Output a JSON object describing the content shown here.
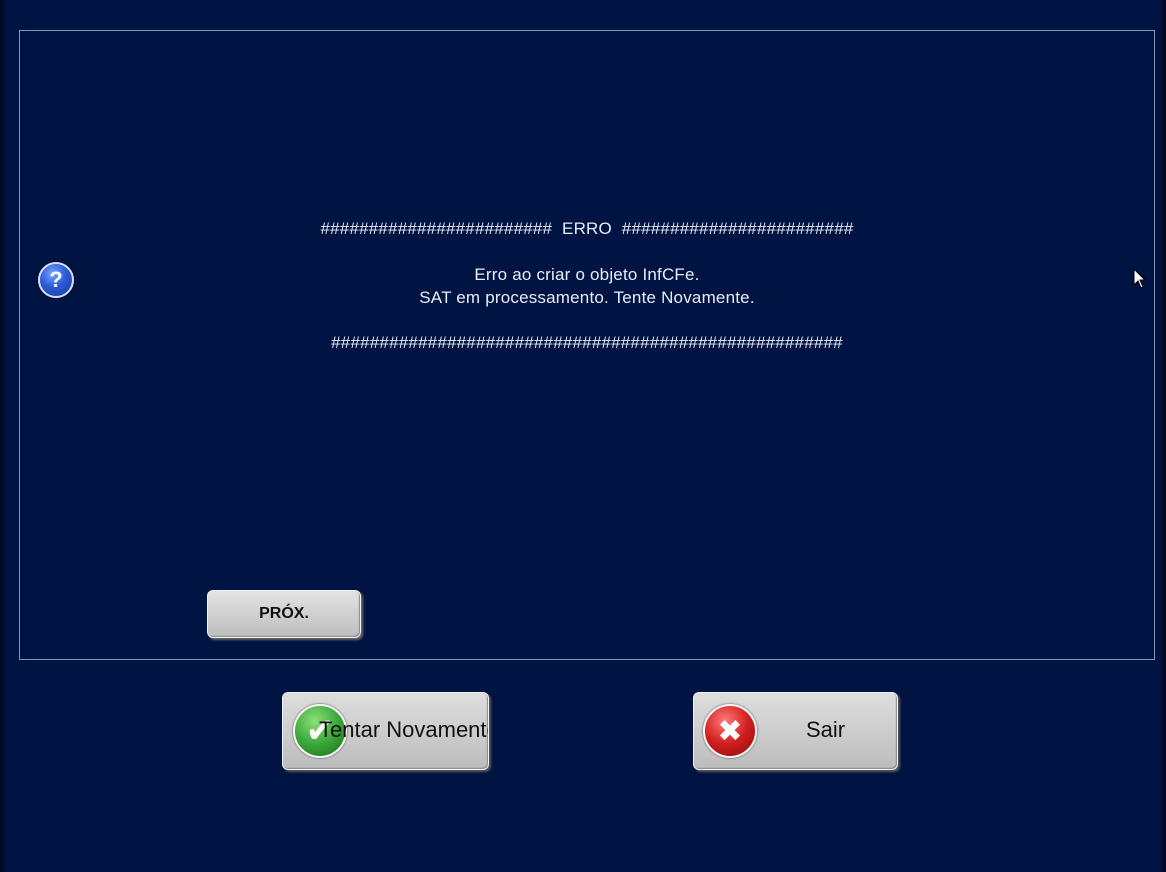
{
  "dialog": {
    "header": "########################  ERRO  ########################",
    "message_lines": [
      "Erro ao criar o objeto InfCFe.",
      "SAT em processamento. Tente Novamente."
    ],
    "footer": "#####################################################"
  },
  "help_button": {
    "label": "?"
  },
  "next_button": {
    "label": "PRÓX."
  },
  "retry_button": {
    "label": "Tentar Novamente",
    "icon": "check-icon"
  },
  "exit_button": {
    "label": "Sair",
    "icon": "x-icon"
  },
  "colors": {
    "background": "#001443",
    "panel_border": "#8a94aa",
    "text": "#e8ecf4",
    "button_face": "#d0d0d0"
  }
}
